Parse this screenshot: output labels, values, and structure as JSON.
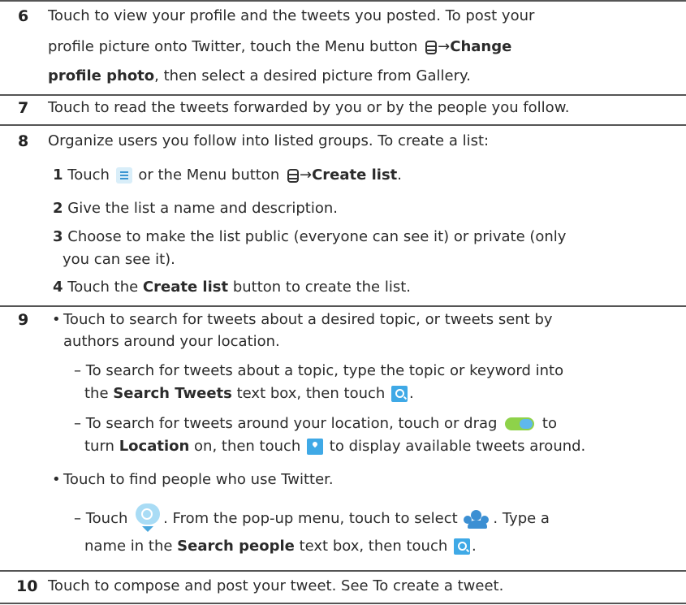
{
  "rows": {
    "r6": {
      "num": "6",
      "l1": "Touch to view your profile and the tweets you posted. To post your",
      "l2a": "profile picture onto Twitter, touch the Menu button ",
      "l2b": "→",
      "l2c": "Change",
      "l3a": "profile photo",
      "l3b": ", then select a desired picture from Gallery."
    },
    "r7": {
      "num": "7",
      "l1": "Touch to read the tweets forwarded by you or by the people you follow."
    },
    "r8": {
      "num": "8",
      "l1": "Organize users you follow into listed groups. To create a list:",
      "s1n": "1",
      "s1a": " Touch ",
      "s1b": " or the Menu button ",
      "s1c": "→",
      "s1d": "Create list",
      "s1e": ".",
      "s2n": "2",
      "s2a": " Give the list a name and description.",
      "s3n": "3",
      "s3a": " Choose to make the list public (everyone can see it) or private (only",
      "s3b": "you can see it).",
      "s4n": "4",
      "s4a": " Touch the ",
      "s4b": "Create list",
      "s4c": " button to create the list."
    },
    "r9": {
      "num": "9",
      "bullet": "•",
      "b1a": "Touch to search for tweets about a desired topic, or tweets sent by",
      "b1b": "authors around your location.",
      "d1a": "– To search for tweets about a topic, type the topic or keyword into",
      "d1b_pre": "the ",
      "d1b_bold": "Search Tweets",
      "d1b_post": " text box, then touch ",
      "d1b_end": ".",
      "d2a": "– To search for tweets around your location, touch or drag ",
      "d2a_end": " to",
      "d2b_pre": "turn ",
      "d2b_bold": "Location",
      "d2b_mid": " on, then touch ",
      "d2b_post": " to display available tweets around.",
      "b2": "Touch to find people who use Twitter.",
      "d3a_pre": "– Touch ",
      "d3a_mid": ". From the pop-up menu, touch to select ",
      "d3a_post": ". Type a",
      "d3b_pre": "name in the ",
      "d3b_bold": "Search people",
      "d3b_post": " text box, then touch ",
      "d3b_end": "."
    },
    "r10": {
      "num": "10",
      "l1": "Touch to compose and post your tweet. See To create a tweet."
    }
  },
  "icons": {
    "menu": "menu-button-icon",
    "list": "create-list-icon",
    "search": "search-icon",
    "toggle": "location-toggle-icon",
    "pin": "location-pin-icon",
    "bubble": "twitter-bubble-menu-icon",
    "people": "people-icon"
  },
  "colors": {
    "accent": "#3fa9e6",
    "toggle_on": "#8ed24a",
    "rule": "#555555",
    "text": "#2b2b2b"
  }
}
